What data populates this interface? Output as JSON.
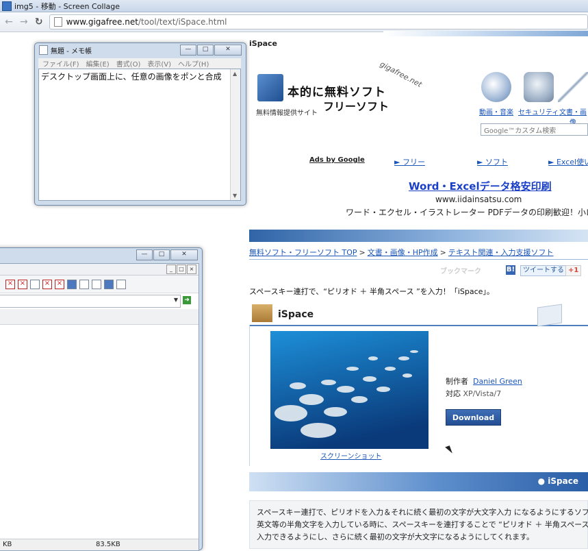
{
  "window": {
    "title": "img5 - 移動 - Screen Collage"
  },
  "browser": {
    "back_icon": "back-arrow-icon",
    "forward_icon": "forward-arrow-icon",
    "reload_icon": "reload-icon",
    "url_host": "www.gigafree.net",
    "url_path": "/tool/text/iSpace.html"
  },
  "page": {
    "title": "iSpace",
    "logo": {
      "line1": "本的に無料ソフト",
      "line2": "フリーソフト",
      "tagline": "無料情報提供サイト",
      "domain": "gigafree.net"
    },
    "categories": [
      "動画・音楽",
      "セキュリティ",
      "文書・画像"
    ],
    "search_placeholder": "Google™カスタム検索",
    "ads": {
      "ads_by": "Ads by Google",
      "links": [
        "► フリー",
        "► ソフト",
        "► Excel使い"
      ]
    },
    "ad": {
      "title": "Word・Excelデータ格安印刷",
      "url": "www.iidainsatsu.com",
      "desc": "ワード・エクセル・イラストレーター PDFデータの印刷歓迎！小ロッ"
    },
    "breadcrumb": [
      "無料ソフト・フリーソフト TOP",
      "文書・画像・HP作成",
      "テキスト関連・入力支援ソフト"
    ],
    "breadcrumb_sep": ">",
    "social": {
      "bookmark": "ブックマーク",
      "b": "B!",
      "tweet": "ツイートする",
      "gplus": "+1"
    },
    "lead": "スペースキー連打で、“ピリオド ＋ 半角スペース ”を入力！「iSpace」。",
    "section_title": "iSpace",
    "screenshot_link": "スクリーンショット",
    "author_label": "制作者",
    "author": "Daniel Green",
    "os_label": "対応",
    "os": "XP/Vista/7",
    "download": "Download",
    "banner": "● iSpace",
    "description": [
      "スペースキー連打で、ピリオドを入力＆それに続く最初の文字が大文字入力 になるようにするソフト。",
      "英文等の半角文字を入力している時に、スペースキーを連打することで “ピリオド ＋ 半角スペース ”を",
      "入力できるようにし、さらに続く最初の文字が大文字になるようにしてくれます。"
    ]
  },
  "notepad": {
    "title": "無題 - メモ帳",
    "menu": [
      "ファイル(F)",
      "編集(E)",
      "書式(O)",
      "表示(V)",
      "ヘルプ(H)"
    ],
    "content": "デスクトップ画面上に、任意の画像をポンと合成"
  },
  "window2": {
    "status_left": "KB",
    "status_right": "83.5KB"
  }
}
